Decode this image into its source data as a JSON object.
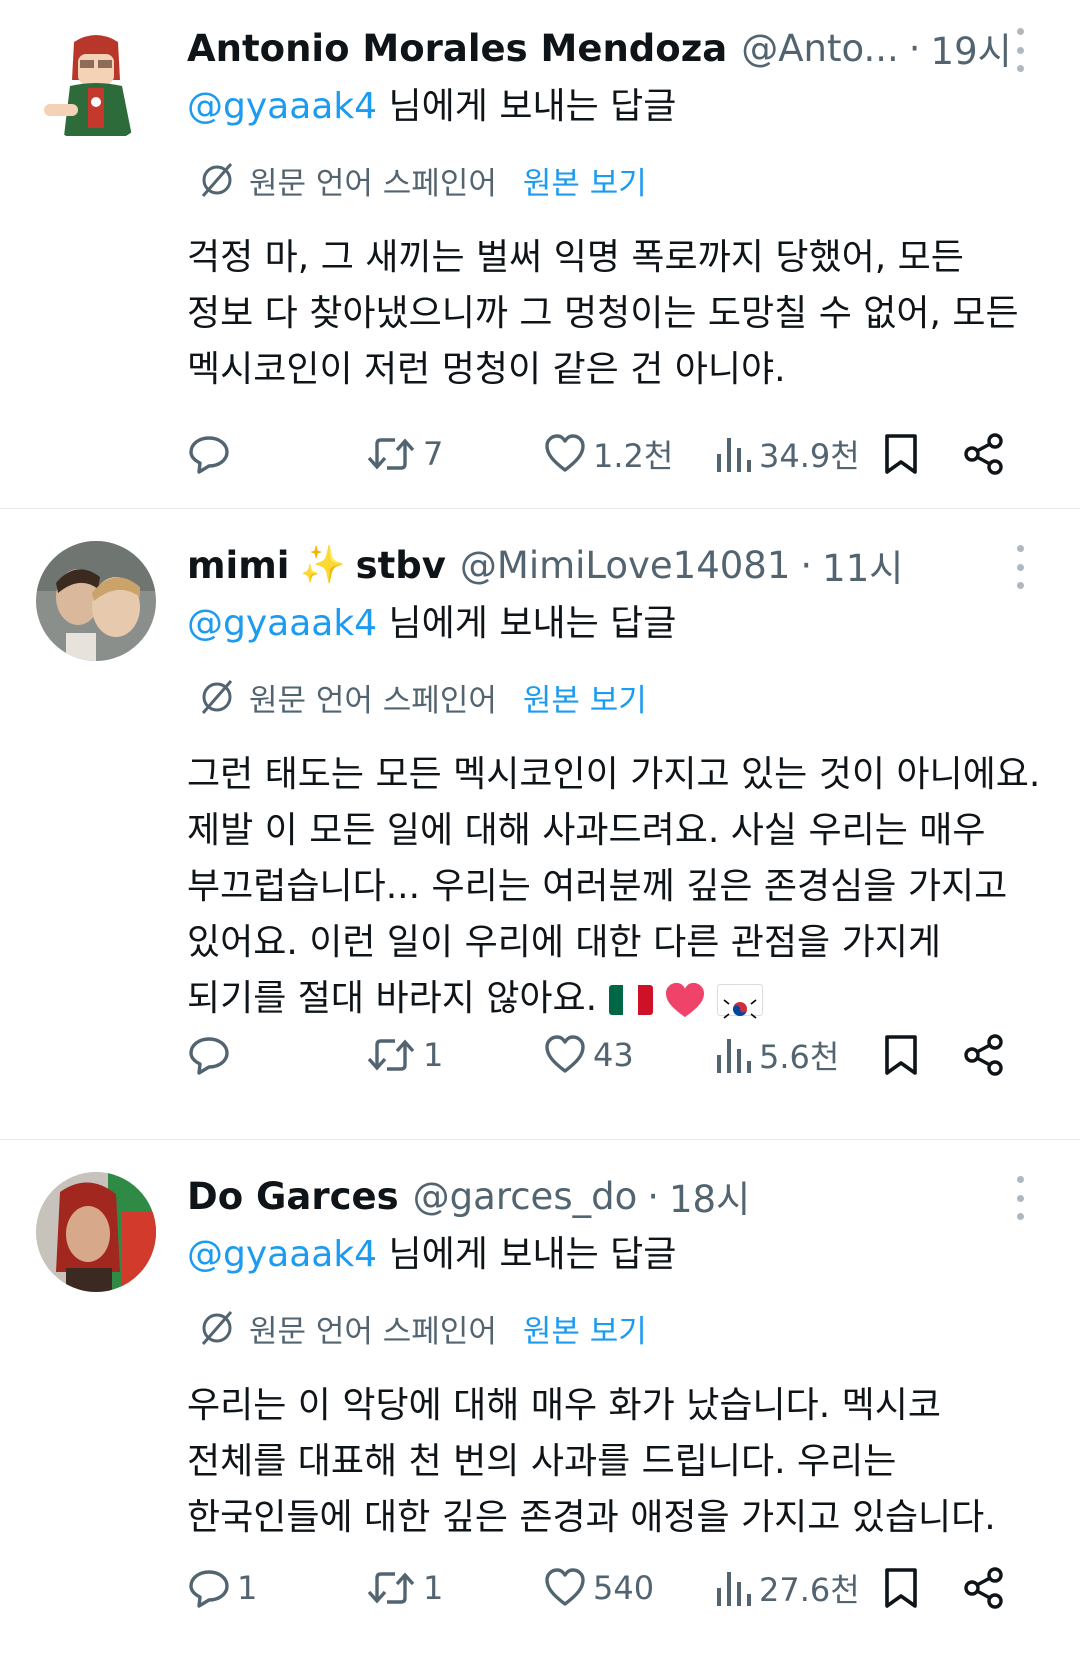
{
  "tweets": [
    {
      "name": "Antonio Morales Mendoza",
      "handle": "@Anto...",
      "time": "19시",
      "reply_prefix": "@gyaaak4",
      "reply_suffix": " 님에게 보내는 답글",
      "translate_lang": "원문 언어 스페인어",
      "translate_link": "원본 보기",
      "body": [
        "걱정 마, 그 새끼는 벌써 익명 폭로까지 당했어, 모든",
        "정보 다 찾아냈으니까 그 멍청이는 도망칠 수 없어, 모든",
        "멕시코인이 저런 멍청이 같은 건 아니야."
      ],
      "replies": "",
      "retweets": "7",
      "likes": "1.2천",
      "views": "34.9천"
    },
    {
      "name": "mimi",
      "name_emoji": "✨",
      "name_suffix": "stbv",
      "handle": "@MimiLove14081",
      "time": "11시",
      "reply_prefix": "@gyaaak4",
      "reply_suffix": " 님에게 보내는 답글",
      "translate_lang": "원문 언어 스페인어",
      "translate_link": "원본 보기",
      "body": [
        "그런 태도는 모든 멕시코인이 가지고 있는 것이 아니에요.",
        "제발 이 모든 일에 대해 사과드려요. 사실 우리는 매우",
        "부끄럽습니다... 우리는 여러분께 깊은 존경심을 가지고",
        "있어요. 이런 일이 우리에 대한 다른 관점을 가지게",
        "되기를 절대 바라지 않아요."
      ],
      "replies": "",
      "retweets": "1",
      "likes": "43",
      "views": "5.6천"
    },
    {
      "name": "Do Garces",
      "handle": "@garces_do",
      "time": "18시",
      "reply_prefix": "@gyaaak4",
      "reply_suffix": " 님에게 보내는 답글",
      "translate_lang": "원문 언어 스페인어",
      "translate_link": "원본 보기",
      "body": [
        "우리는 이 악당에 대해 매우 화가 났습니다. 멕시코",
        "전체를 대표해 천 번의 사과를 드립니다. 우리는",
        "한국인들에 대한 깊은 존경과 애정을 가지고 있습니다."
      ],
      "replies": "1",
      "retweets": "1",
      "likes": "540",
      "views": "27.6천"
    }
  ],
  "colors": {
    "link": "#1d9bf0",
    "secondary": "#536471",
    "text": "#0f1419"
  }
}
